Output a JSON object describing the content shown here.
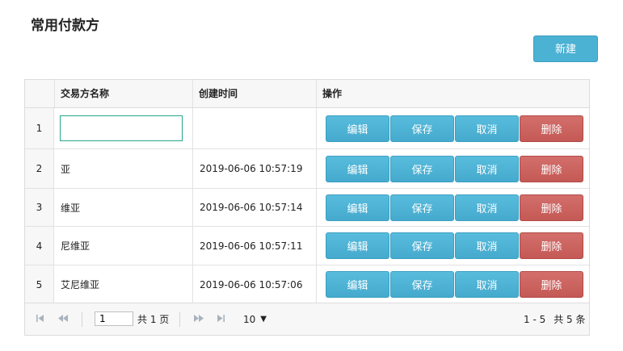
{
  "page": {
    "title": "常用付款方"
  },
  "toolbar": {
    "new_label": "新建"
  },
  "table": {
    "columns": {
      "name": "交易方名称",
      "time": "创建时间",
      "ops": "操作"
    },
    "actions": {
      "edit": "编辑",
      "save": "保存",
      "cancel": "取消",
      "delete": "删除"
    },
    "rows": [
      {
        "index": "1",
        "name": "",
        "time": ""
      },
      {
        "index": "2",
        "name": "亚",
        "time": "2019-06-06  10:57:19"
      },
      {
        "index": "3",
        "name": "维亚",
        "time": "2019-06-06  10:57:14"
      },
      {
        "index": "4",
        "name": "尼维亚",
        "time": "2019-06-06  10:57:11"
      },
      {
        "index": "5",
        "name": "艾尼维亚",
        "time": "2019-06-06  10:57:06"
      }
    ]
  },
  "pager": {
    "current_page": "1",
    "total_pages_text": "共 1 页",
    "page_size": "10",
    "range_text": "1 - 5",
    "total_items_text": "共 5 条"
  },
  "colors": {
    "primary_button": "#4bb2d4",
    "danger_button": "#c9605c",
    "input_focus_border": "#2aa58a"
  },
  "icons": [
    "first-page-icon",
    "prev-page-icon",
    "next-page-icon",
    "last-page-icon",
    "dropdown-arrow-icon"
  ]
}
